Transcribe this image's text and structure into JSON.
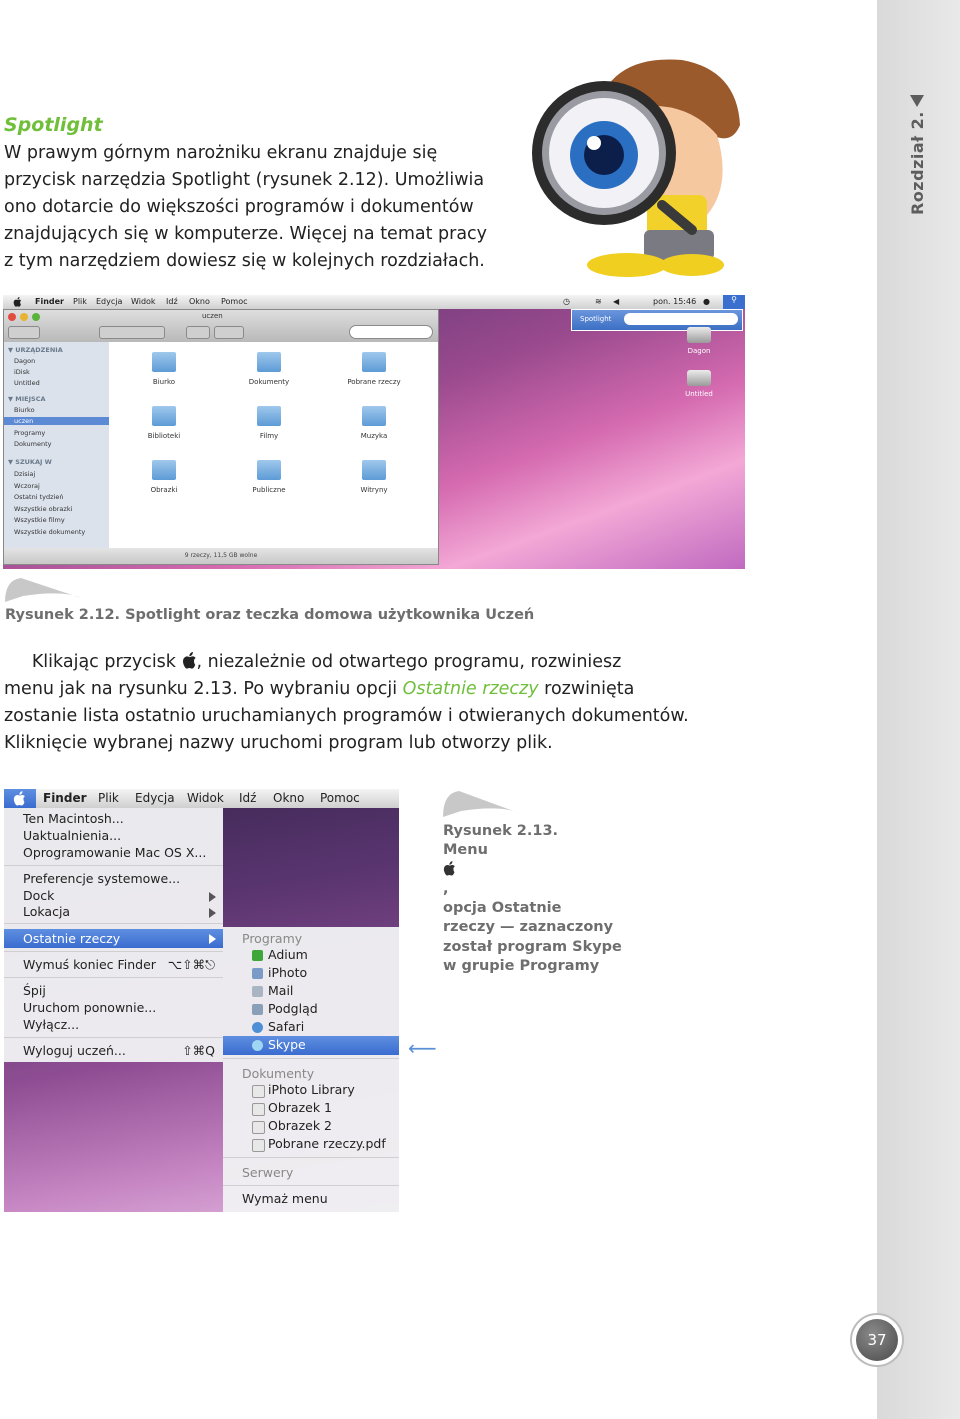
{
  "chapter_label": "Rozdział 2.",
  "page_number": "37",
  "section_title": "Spotlight",
  "para1": [
    "W prawym górnym narożniku ekranu znajduje się",
    "przycisk narzędzia Spotlight (rysunek 2.12). Umożliwia",
    "ono dotarcie do większości programów i dokumentów",
    "znajdujących się w komputerze. Więcej na temat pracy",
    "z tym narzędziem dowiesz się w kolejnych rozdziałach."
  ],
  "para2": {
    "l1_a": "Klikając przycisk ",
    "l1_b": ", niezależnie od otwartego programu, rozwiniesz",
    "l2_a": "menu jak na rysunku 2.13. Po wybraniu opcji ",
    "l2_em": "Ostatnie rzeczy",
    "l2_b": " rozwinięta",
    "l3": "zostanie lista ostatnio uruchamianych programów i otwieranych dokumentów.",
    "l4": "Kliknięcie wybranej nazwy uruchomi program lub otworzy plik."
  },
  "caption1": "Rysunek 2.12. Spotlight oraz teczka domowa użytkownika Uczeń",
  "caption2": {
    "l1": "Rysunek 2.13.",
    "l2": "Menu ",
    "l2_b": ",",
    "l3": "opcja Ostatnie",
    "l4": "rzeczy — zaznaczony",
    "l5": "został program Skype",
    "l6": "w grupie Programy"
  },
  "shot1": {
    "menubar": [
      "Finder",
      "Plik",
      "Edycja",
      "Widok",
      "Idź",
      "Okno",
      "Pomoc"
    ],
    "clock": "pon. 15:46",
    "window_title": "uczen",
    "spotlight_label": "Spotlight",
    "sidebar": {
      "h1": "▼ URZĄDZENIA",
      "devices": [
        "Dagon",
        "iDisk",
        "Untitled"
      ],
      "h2": "▼ MIEJSCA",
      "places": [
        "Biurko",
        "uczen",
        "Programy",
        "Dokumenty"
      ],
      "h3": "▼ SZUKAJ W",
      "search": [
        "Dzisiaj",
        "Wczoraj",
        "Ostatni tydzień",
        "Wszystkie obrazki",
        "Wszystkie filmy",
        "Wszystkie dokumenty"
      ]
    },
    "folders": [
      "Biurko",
      "Dokumenty",
      "Pobrane rzeczy",
      "Biblioteki",
      "Filmy",
      "Muzyka",
      "Obrazki",
      "Publiczne",
      "Witryny"
    ],
    "status": "9 rzeczy, 11,5 GB wolne",
    "disks": [
      "Dagon",
      "Untitled"
    ]
  },
  "shot2": {
    "menubar": [
      "Finder",
      "Plik",
      "Edycja",
      "Widok",
      "Idź",
      "Okno",
      "Pomoc"
    ],
    "apple_menu": {
      "about": "Ten Macintosh...",
      "update": "Uaktualnienia...",
      "software": "Oprogramowanie Mac OS X...",
      "prefs": "Preferencje systemowe...",
      "dock": "Dock",
      "location": "Lokacja",
      "recent": "Ostatnie rzeczy",
      "force_quit": "Wymuś koniec Finder",
      "force_quit_sc": "⌥⇧⌘⎋",
      "sleep": "Śpij",
      "restart": "Uruchom ponownie...",
      "shutdown": "Wyłącz...",
      "logout": "Wyloguj uczeń...",
      "logout_sc": "⇧⌘Q"
    },
    "submenu": {
      "programs_header": "Programy",
      "programs": [
        "Adium",
        "iPhoto",
        "Mail",
        "Podgląd",
        "Safari",
        "Skype"
      ],
      "docs_header": "Dokumenty",
      "documents": [
        "iPhoto Library",
        "Obrazek 1",
        "Obrazek 2",
        "Pobrane rzeczy.pdf"
      ],
      "servers_header": "Serwery",
      "clear": "Wymaż menu"
    }
  }
}
